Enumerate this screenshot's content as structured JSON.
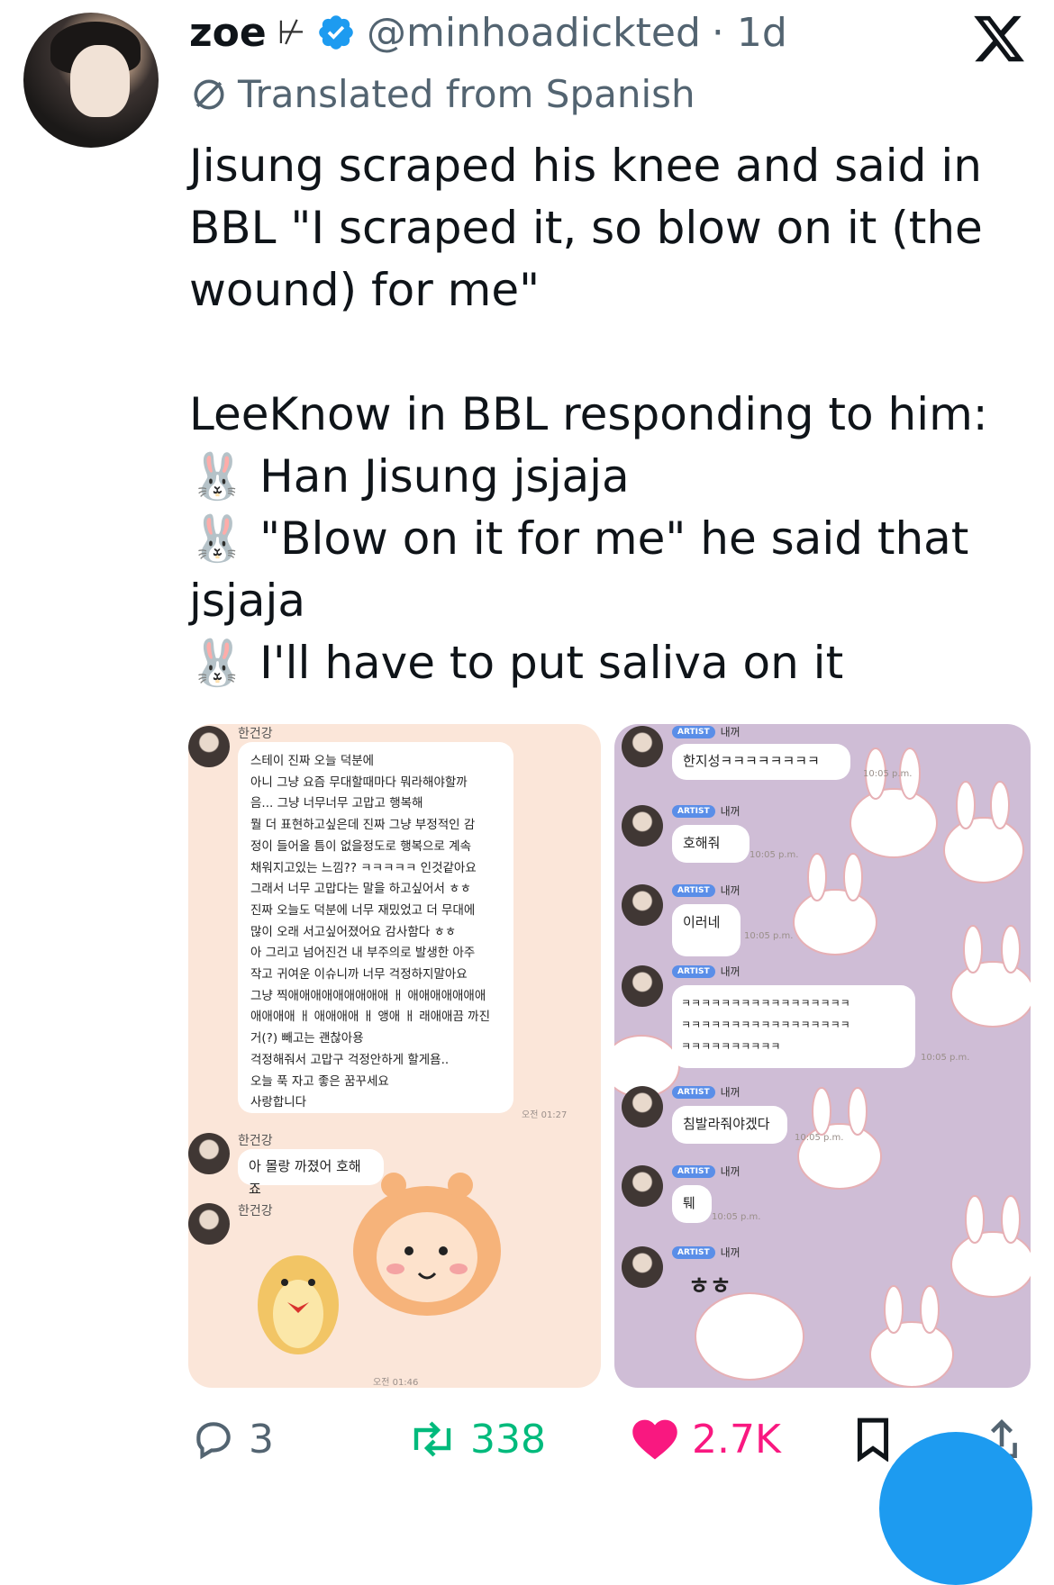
{
  "user": {
    "name": "zoe",
    "flag_glyph": "⊬",
    "handle": "@minhoadickted",
    "time": "· 1d"
  },
  "translated_label": "Translated from Spanish",
  "tweet_text": "Jisung scraped his knee and said in BBL \"I scraped it, so blow on it (the wound) for me\"\n\nLeeKnow in BBL responding to him:\n🐰 Han Jisung jsjaja\n🐰 \"Blow on it for me\" he said that jsjaja\n🐰 I'll have to put saliva on it",
  "media_left": {
    "sender": "한건강",
    "sender2": "한건강",
    "sender3": "한건강",
    "message_lines": "스테이 진짜 오늘 덕분에\n아니 그냥 요즘 무대할때마다 뭐라해야할까\n음... 그냥 너무너무 고맙고 행복해\n뭘 더 표현하고싶은데 진짜 그냥 부정적인 감\n정이 들어올 틈이 없을정도로 행복으로 계속\n채워지고있는 느낌?? ㅋㅋㅋㅋㅋ 인것같아요\n그래서 너무 고맙다는 말을 하고싶어서 ㅎㅎ\n진짜 오늘도 덕분에 너무 재밌었고 더 무대에\n많이 오래 서고싶어졌어요 감사함다 ㅎㅎ\n아 그리고 넘어진건 내 부주의로 발생한 아주\n작고 귀여운 이슈니까 너무 걱정하지말아요\n그냥 찍애애애애애애애애애 ㅐ 애애애애애애애\n애애애애 ㅐ 애애애애 ㅐ 앵애 ㅐ 래애애끔 까진\n거(?) 빼고는 괜찮아용\n걱정해줘서 고맙구 걱정안하게 할게욤..\n오늘 푹 자고 좋은 꿈꾸세요\n사랑합니다",
    "time1": "오전 01:27",
    "message2": "아 몰랑 까졌어 호해죠",
    "time2": "오전 01:46"
  },
  "media_right": {
    "badge": "ARTIST",
    "artist_name": "내꺼",
    "messages": [
      {
        "text": "한지성ㅋㅋㅋㅋㅋㅋㅋㅋ",
        "time": "10:05 p.m."
      },
      {
        "text": "호해줘",
        "time": "10:05 p.m."
      },
      {
        "text": "이러네",
        "time": "10:05 p.m."
      },
      {
        "text": "ㅋㅋㅋㅋㅋㅋㅋㅋㅋㅋㅋㅋㅋㅋㅋㅋㅋ\nㅋㅋㅋㅋㅋㅋㅋㅋㅋㅋㅋㅋㅋㅋㅋㅋㅋ\nㅋㅋㅋㅋㅋㅋㅋㅋㅋㅋ",
        "time": "10:05 p.m."
      },
      {
        "text": "침발라줘야겠다",
        "time": "10:05 p.m."
      },
      {
        "text": "퉤",
        "time": "10:05 p.m."
      },
      {
        "text": "ㅎㅎ",
        "time": ""
      }
    ]
  },
  "actions": {
    "replies": "3",
    "reposts": "338",
    "likes": "2.7K"
  },
  "colors": {
    "repost_green": "#00ba7c",
    "like_pink": "#f91880",
    "verified_blue": "#1d9bf0"
  }
}
